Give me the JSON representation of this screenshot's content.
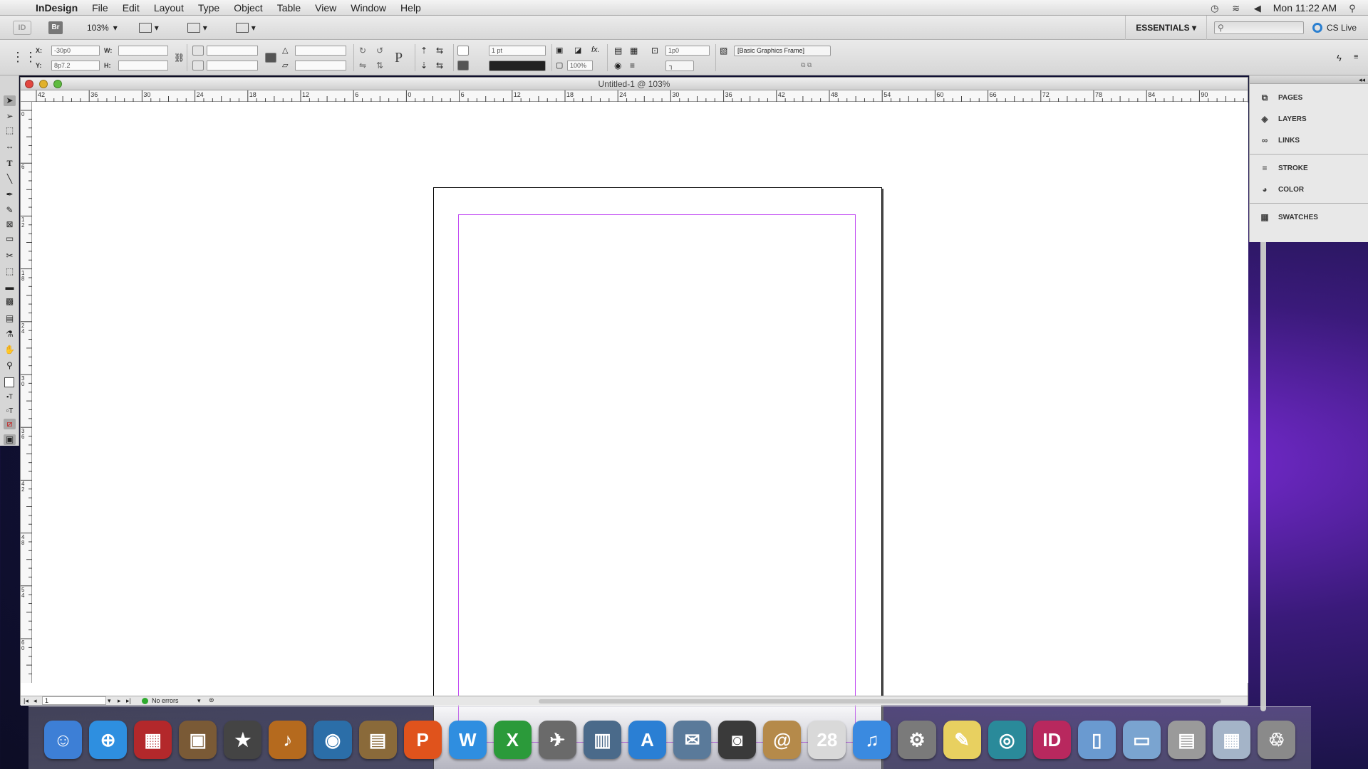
{
  "menubar": {
    "app_name": "InDesign",
    "items": [
      "File",
      "Edit",
      "Layout",
      "Type",
      "Object",
      "Table",
      "View",
      "Window",
      "Help"
    ],
    "clock": "Mon 11:22 AM"
  },
  "appbar": {
    "logo": "ID",
    "bridge": "Br",
    "zoom": "103%",
    "workspace": "ESSENTIALS",
    "cs_live": "CS Live"
  },
  "control": {
    "x_label": "X:",
    "x_value": "-30p0",
    "y_label": "Y:",
    "y_value": "8p7.2",
    "w_label": "W:",
    "h_label": "H:",
    "stroke_weight": "1 pt",
    "opacity": "100%",
    "gap": "1p0",
    "object_style": "[Basic Graphics Frame]"
  },
  "document": {
    "title": "Untitled-1 @ 103%",
    "page_number": "1",
    "preflight": "No errors",
    "hruler_labels": [
      "42",
      "36",
      "30",
      "24",
      "18",
      "12",
      "6",
      "0",
      "6",
      "12",
      "18",
      "24",
      "30",
      "36",
      "42",
      "48",
      "54",
      "60",
      "66",
      "72",
      "78",
      "84",
      "90"
    ],
    "vruler_labels": [
      "0",
      "6",
      "1 2",
      "1 8",
      "2 4",
      "3 0",
      "3 6",
      "4 2",
      "4 8",
      "5 4",
      "6 0"
    ]
  },
  "panels": {
    "group1": [
      "PAGES",
      "LAYERS",
      "LINKS"
    ],
    "group2": [
      "STROKE",
      "COLOR"
    ],
    "group3": [
      "SWATCHES"
    ]
  },
  "dock": {
    "items": [
      {
        "name": "finder",
        "glyph": "☺",
        "color": "#3d7fd6"
      },
      {
        "name": "safari",
        "glyph": "⊕",
        "color": "#2e8fe0"
      },
      {
        "name": "dvd-player",
        "glyph": "▦",
        "color": "#b3282b"
      },
      {
        "name": "iphoto",
        "glyph": "▣",
        "color": "#7a5a36"
      },
      {
        "name": "imovie",
        "glyph": "★",
        "color": "#444444"
      },
      {
        "name": "garageband",
        "glyph": "♪",
        "color": "#b56a1e"
      },
      {
        "name": "idvd",
        "glyph": "◉",
        "color": "#2b6ea8"
      },
      {
        "name": "preview",
        "glyph": "▤",
        "color": "#8a6a3a"
      },
      {
        "name": "powerpoint",
        "glyph": "P",
        "color": "#e0531c"
      },
      {
        "name": "word",
        "glyph": "W",
        "color": "#2f8ee0"
      },
      {
        "name": "excel",
        "glyph": "X",
        "color": "#2b9a3a"
      },
      {
        "name": "launchpad",
        "glyph": "✈",
        "color": "#6a6a6a"
      },
      {
        "name": "photo-booth",
        "glyph": "▥",
        "color": "#4a6a8a"
      },
      {
        "name": "app-store",
        "glyph": "A",
        "color": "#2a7fd4"
      },
      {
        "name": "mail",
        "glyph": "✉",
        "color": "#5a7a9a"
      },
      {
        "name": "facetime",
        "glyph": "◙",
        "color": "#3a3a3a"
      },
      {
        "name": "address-book",
        "glyph": "@",
        "color": "#b58a4a"
      },
      {
        "name": "ical",
        "glyph": "28",
        "color": "#d9d9d9"
      },
      {
        "name": "itunes",
        "glyph": "♫",
        "color": "#3a8ae0"
      },
      {
        "name": "system-preferences",
        "glyph": "⚙",
        "color": "#7a7a7a"
      },
      {
        "name": "stickies",
        "glyph": "✎",
        "color": "#e8d060"
      },
      {
        "name": "archive-utility",
        "glyph": "◎",
        "color": "#2a8a9a"
      },
      {
        "name": "indesign",
        "glyph": "ID",
        "color": "#b8285e"
      },
      {
        "name": "documents",
        "glyph": "▯",
        "color": "#6a9ad0"
      },
      {
        "name": "applications-folder",
        "glyph": "▭",
        "color": "#7aa4d0"
      },
      {
        "name": "downloads-stack",
        "glyph": "▤",
        "color": "#9a9a9a"
      },
      {
        "name": "screenshot-stack",
        "glyph": "▦",
        "color": "#a4b4c8"
      },
      {
        "name": "trash",
        "glyph": "♲",
        "color": "#8a8a8a"
      }
    ]
  }
}
